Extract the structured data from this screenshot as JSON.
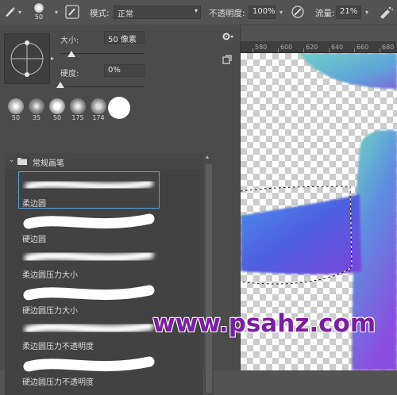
{
  "options_bar": {
    "brush_size": "50",
    "mode_label": "模式:",
    "mode_value": "正常",
    "opacity_label": "不透明度:",
    "opacity_value": "100%",
    "flow_label": "流量:",
    "flow_value": "21%"
  },
  "brush_panel": {
    "size_label": "大小:",
    "size_value": "50 像素",
    "size_level": 0.13,
    "hardness_label": "硬度:",
    "hardness_value": "0%",
    "hardness_level": 0.0,
    "recent_brushes": [
      {
        "size": "50"
      },
      {
        "size": "35"
      },
      {
        "size": "50"
      },
      {
        "size": "175"
      },
      {
        "size": "174"
      },
      {
        "size": ""
      }
    ],
    "group_name": "常规画笔",
    "brushes": [
      {
        "label": "柔边圆"
      },
      {
        "label": "硬边圆"
      },
      {
        "label": "柔边圆压力大小"
      },
      {
        "label": "硬边圆压力大小"
      },
      {
        "label": "柔边圆压力不透明度"
      },
      {
        "label": "硬边圆压力不透明度"
      }
    ]
  },
  "ruler": {
    "ticks": [
      "580",
      "600",
      "620",
      "640",
      "660",
      "680"
    ]
  },
  "watermark": "www.psahz.com",
  "colors": {
    "accent_selection": "#5aa0d6",
    "watermark": "#7a1fa0"
  }
}
